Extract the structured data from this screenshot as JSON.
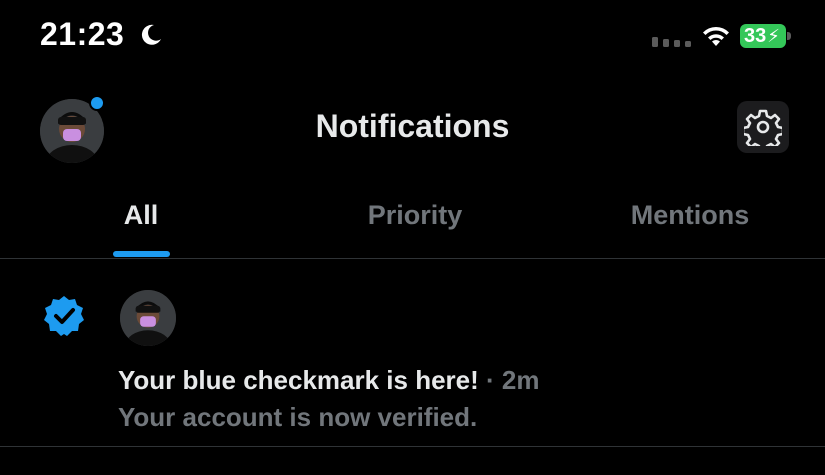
{
  "status_bar": {
    "time": "21:23",
    "moon_icon": "moon-icon",
    "signal_icon": "cellular-signal-icon",
    "wifi_icon": "wifi-icon",
    "battery_level": "33",
    "battery_charging_icon": "lightning-bolt-icon",
    "battery_color": "#34c759"
  },
  "header": {
    "title": "Notifications",
    "avatar_icon": "profile-avatar",
    "unread_dot_color": "#1d9bf0",
    "settings_icon": "gear-icon"
  },
  "tabs": [
    {
      "label": "All",
      "active": true
    },
    {
      "label": "Priority",
      "active": false
    },
    {
      "label": "Mentions",
      "active": false
    }
  ],
  "accent_color": "#1d9bf0",
  "notifications": [
    {
      "icon": "verified-badge-icon",
      "title": "Your blue checkmark is here!",
      "separator": " · ",
      "time": "2m",
      "body": "Your account is now verified."
    }
  ]
}
